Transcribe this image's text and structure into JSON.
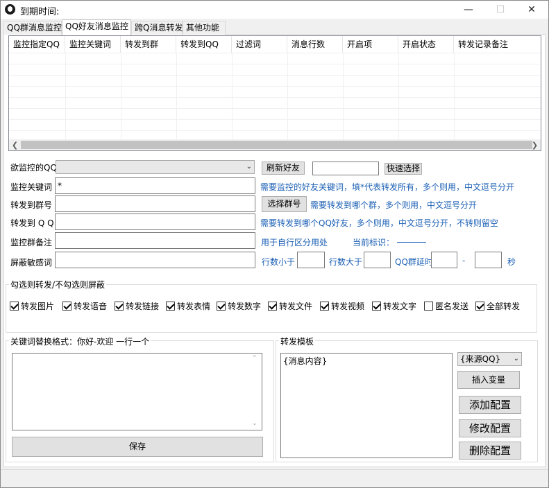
{
  "window": {
    "title": "到期时间:",
    "min_glyph": "—",
    "max_glyph": "☐",
    "close_glyph": "✕"
  },
  "tabs": [
    {
      "label": "QQ群消息监控",
      "active": false
    },
    {
      "label": "QQ好友消息监控",
      "active": true
    },
    {
      "label": "跨Q消息转发",
      "active": false
    },
    {
      "label": "其他功能",
      "active": false
    }
  ],
  "table": {
    "columns": [
      "监控指定QQ",
      "监控关键词",
      "转发到群",
      "转发到QQ",
      "过滤词",
      "消息行数",
      "开启项",
      "开启状态",
      "转发记录备注"
    ],
    "rows": []
  },
  "form": {
    "monitor_qq_label": "欲监控的QQ",
    "monitor_qq_value": "",
    "refresh_friends_button": "刷新好友",
    "quick_select_value": "",
    "quick_select_button": "快速选择",
    "keyword_label": "监控关键词",
    "keyword_value": "*",
    "keyword_hint": "需要监控的好友关键词，填*代表转发所有，多个则用，中文逗号分开",
    "forward_group_label": "转发到群号",
    "forward_group_value": "",
    "select_group_button": "选择群号",
    "forward_group_hint": "需要转发到哪个群，多个则用，中文逗号分开",
    "forward_qq_label": "转发到 Q Q",
    "forward_qq_value": "",
    "forward_qq_hint": "需要转发到哪个QQ好友，多个则用，中文逗号分开，不转则留空",
    "remark_label": "监控群备注",
    "remark_value": "",
    "remark_hint": "用于自行区分用处",
    "current_mark_label": "当前标识：",
    "filter_label": "屏蔽敏感词",
    "filter_value": "",
    "lines_less_label": "行数小于",
    "lines_less_value": "",
    "lines_more_label": "行数大于",
    "lines_more_value": "",
    "delay_label": "QQ群延时",
    "delay_from": "",
    "delay_dash": "-",
    "delay_to": "",
    "delay_unit": "秒"
  },
  "options": {
    "title": "勾选则转发/不勾选则屏蔽",
    "items": [
      {
        "label": "转发图片",
        "checked": true
      },
      {
        "label": "转发语音",
        "checked": true
      },
      {
        "label": "转发链接",
        "checked": true
      },
      {
        "label": "转发表情",
        "checked": true
      },
      {
        "label": "转发数字",
        "checked": true
      },
      {
        "label": "转发文件",
        "checked": true
      },
      {
        "label": "转发视频",
        "checked": true
      },
      {
        "label": "转发文字",
        "checked": true
      },
      {
        "label": "匿名发送",
        "checked": false
      },
      {
        "label": "全部转发",
        "checked": true
      }
    ]
  },
  "replace": {
    "title": "关键词替换格式：你好-欢迎 一行一个",
    "value": "",
    "save_button": "保存"
  },
  "template": {
    "title": "转发模板",
    "value": "{消息内容}",
    "source_select": "{来源QQ}",
    "insert_button": "插入变量",
    "add_button": "添加配置",
    "modify_button": "修改配置",
    "delete_button": "删除配置"
  }
}
